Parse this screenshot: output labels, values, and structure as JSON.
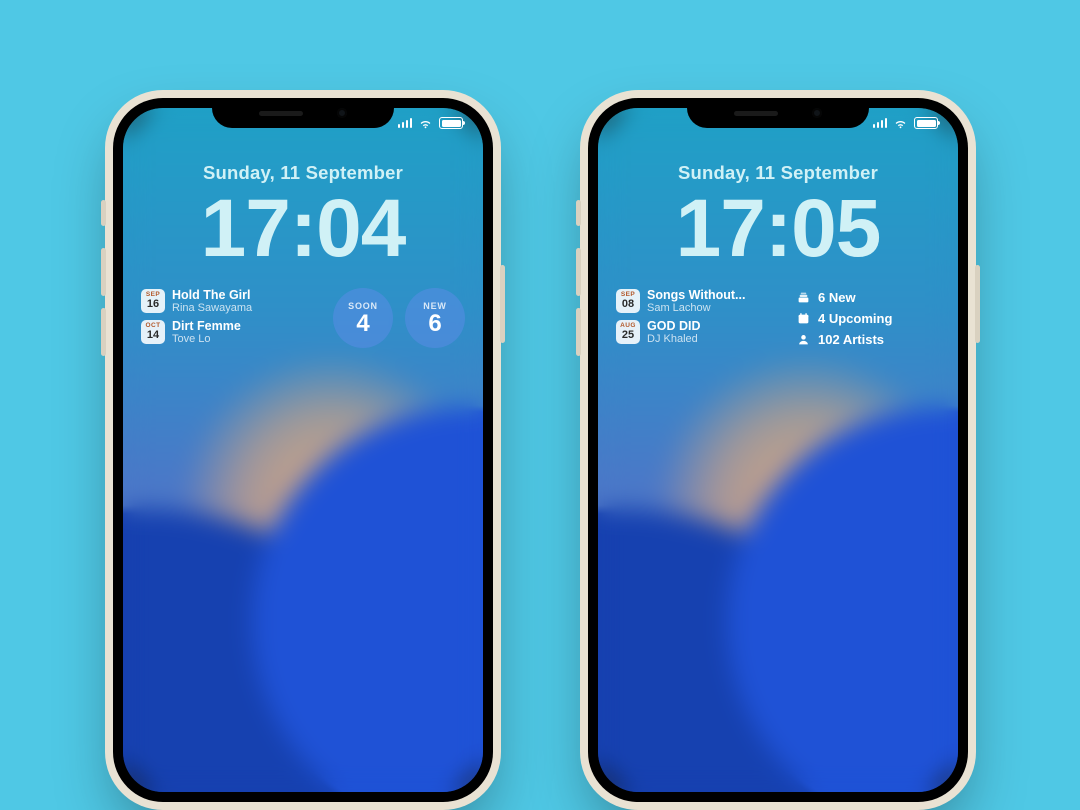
{
  "phones": [
    {
      "date": "Sunday, 11 September",
      "time": "17:04",
      "albums": [
        {
          "month": "SEP",
          "day": "16",
          "title": "Hold The Girl",
          "artist": "Rina Sawayama"
        },
        {
          "month": "OCT",
          "day": "14",
          "title": "Dirt Femme",
          "artist": "Tove Lo"
        }
      ],
      "circles": [
        {
          "label": "SOON",
          "value": "4"
        },
        {
          "label": "NEW",
          "value": "6"
        }
      ]
    },
    {
      "date": "Sunday, 11 September",
      "time": "17:05",
      "albums": [
        {
          "month": "SEP",
          "day": "08",
          "title": "Songs Without...",
          "artist": "Sam Lachow"
        },
        {
          "month": "AUG",
          "day": "25",
          "title": "GOD DID",
          "artist": "DJ Khaled"
        }
      ],
      "stats": [
        {
          "icon": "new",
          "text": "6 New"
        },
        {
          "icon": "upcoming",
          "text": "4 Upcoming"
        },
        {
          "icon": "artists",
          "text": "102 Artists"
        }
      ]
    }
  ]
}
